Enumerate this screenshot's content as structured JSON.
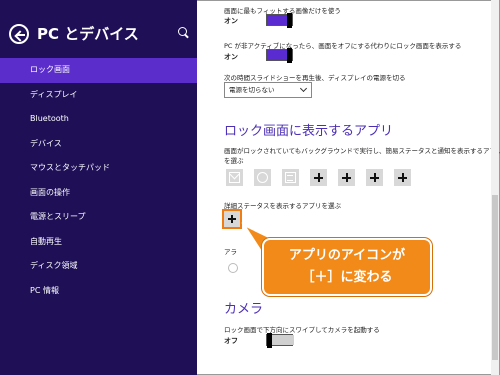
{
  "sidebar": {
    "title": "PC とデバイス",
    "items": [
      {
        "label": "ロック画面",
        "active": true
      },
      {
        "label": "ディスプレイ"
      },
      {
        "label": "Bluetooth"
      },
      {
        "label": "デバイス"
      },
      {
        "label": "マウスとタッチパッド"
      },
      {
        "label": "画面の操作"
      },
      {
        "label": "電源とスリープ"
      },
      {
        "label": "自動再生"
      },
      {
        "label": "ディスク領域"
      },
      {
        "label": "PC 情報"
      }
    ]
  },
  "main": {
    "fit_label": "画面に最もフィットする画像だけを使う",
    "fit_state": "オン",
    "inactive_label": "PC が非アクティブになったら、画面をオフにする代わりにロック画面を表示する",
    "inactive_state": "オン",
    "slideshow_label": "次の時間スライドショーを再生後、ディスプレイの電源を切る",
    "slideshow_value": "電源を切らない",
    "apps_section_title": "ロック画面に表示するアプリ",
    "apps_desc_line1": "画面がロックされていてもバックグラウンドで実行し、簡易ステータスと通知を表示するアプリ",
    "apps_desc_line2": "を選ぶ",
    "detailed_label": "詳細ステータスを表示するアプリを選ぶ",
    "alarm_partial": "アラ",
    "camera_section_title": "カメラ",
    "camera_label": "ロック画面で下方向にスワイプしてカメラを起動する",
    "camera_state": "オフ"
  },
  "callout": {
    "line1": "アプリのアイコンが",
    "line2": "［＋］に変わる"
  },
  "colors": {
    "sidebar_bg": "#1e0f57",
    "sidebar_active": "#5b2ecc",
    "toggle_on": "#5a2bd1",
    "section_title": "#4b2fb5",
    "callout": "#f28a1a"
  },
  "icons": {
    "app_slots": [
      "mail-icon",
      "alarm-icon",
      "calendar-icon",
      "plus-icon",
      "plus-icon",
      "plus-icon",
      "plus-icon"
    ]
  }
}
